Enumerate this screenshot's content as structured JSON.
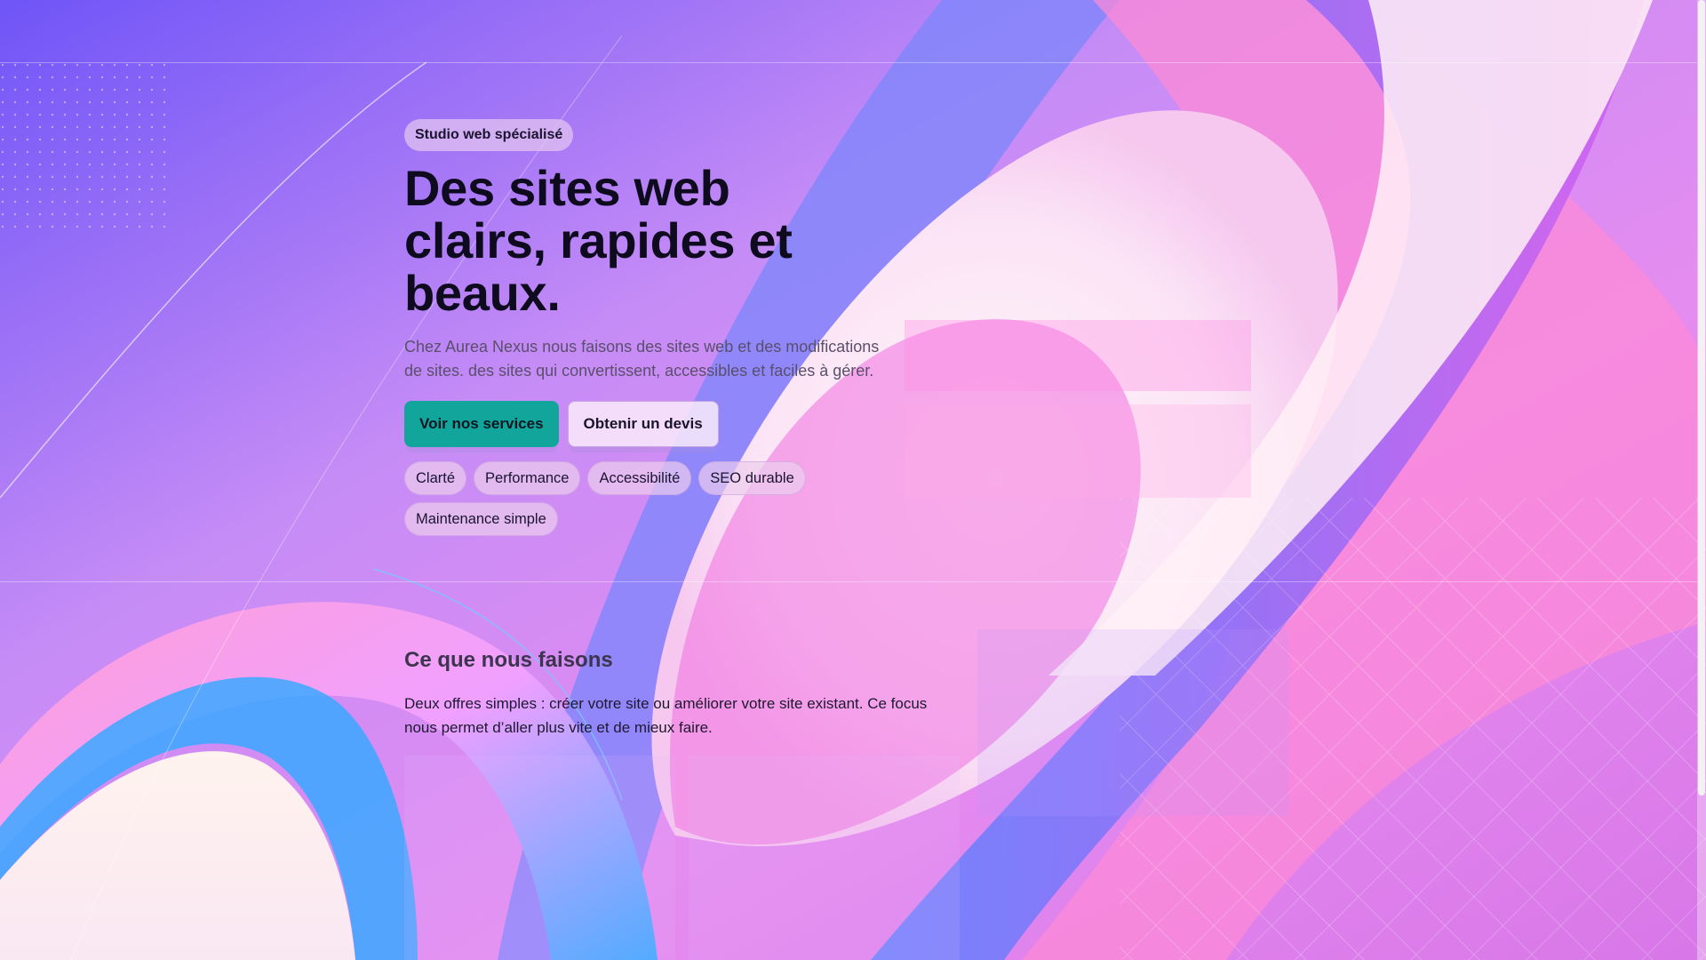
{
  "hero": {
    "badge": "Studio web spécialisé",
    "headline_line1": "Des sites web",
    "headline_line2": "clairs, rapides et",
    "headline_line3": "beaux.",
    "lead": "Chez Aurea Nexus nous faisons des sites web et des modifications de sites. des sites qui convertissent, accessibles et faciles à gérer.",
    "primary_button": "Voir nos services",
    "secondary_button": "Obtenir un devis",
    "chips": [
      "Clarté",
      "Performance",
      "Accessibilité",
      "SEO durable",
      "Maintenance simple"
    ]
  },
  "services": {
    "title": "Ce que nous faisons",
    "description": "Deux offres simples : créer votre site ou améliorer votre site existant. Ce focus nous permet d’aller plus vite et de mieux faire."
  },
  "colors": {
    "accent": "#12a59c",
    "text_dark": "#0f0b1e",
    "background_gradient": [
      "#7a5cf5",
      "#e070f0",
      "#fbe8f6"
    ]
  }
}
